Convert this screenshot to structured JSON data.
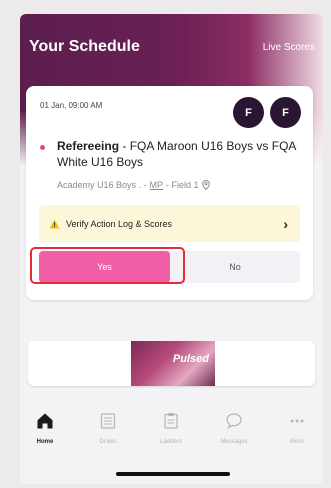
{
  "header": {
    "title": "Your Schedule",
    "live_scores": "Live Scores"
  },
  "match_card": {
    "datetime": "01 Jan, 09:00 AM",
    "avatars": [
      "F",
      "F"
    ],
    "role": "Refereeing",
    "separator": " - ",
    "fixture": "FQA Maroon U16 Boys vs FQA White U16 Boys",
    "venue_prefix": "Academy U16 Boys . - ",
    "venue_code": "MP",
    "venue_suffix": " - Field 1",
    "verify_label": "Verify Action Log & Scores",
    "yes_label": "Yes",
    "no_label": "No"
  },
  "banner": {
    "text": "Pulsed"
  },
  "tabs": [
    {
      "label": "Home",
      "icon": "home-icon",
      "active": true
    },
    {
      "label": "Draws",
      "icon": "draws-icon",
      "active": false
    },
    {
      "label": "Ladders",
      "icon": "ladders-icon",
      "active": false
    },
    {
      "label": "Messages",
      "icon": "messages-icon",
      "active": false
    },
    {
      "label": "More",
      "icon": "more-icon",
      "active": false
    }
  ],
  "colors": {
    "header_gradient_start": "#5b1e4d",
    "accent_pink": "#f05ea6",
    "avatar_bg": "#2a1633",
    "verify_bg": "#fbf7d8",
    "highlight_red": "#e52b36"
  }
}
